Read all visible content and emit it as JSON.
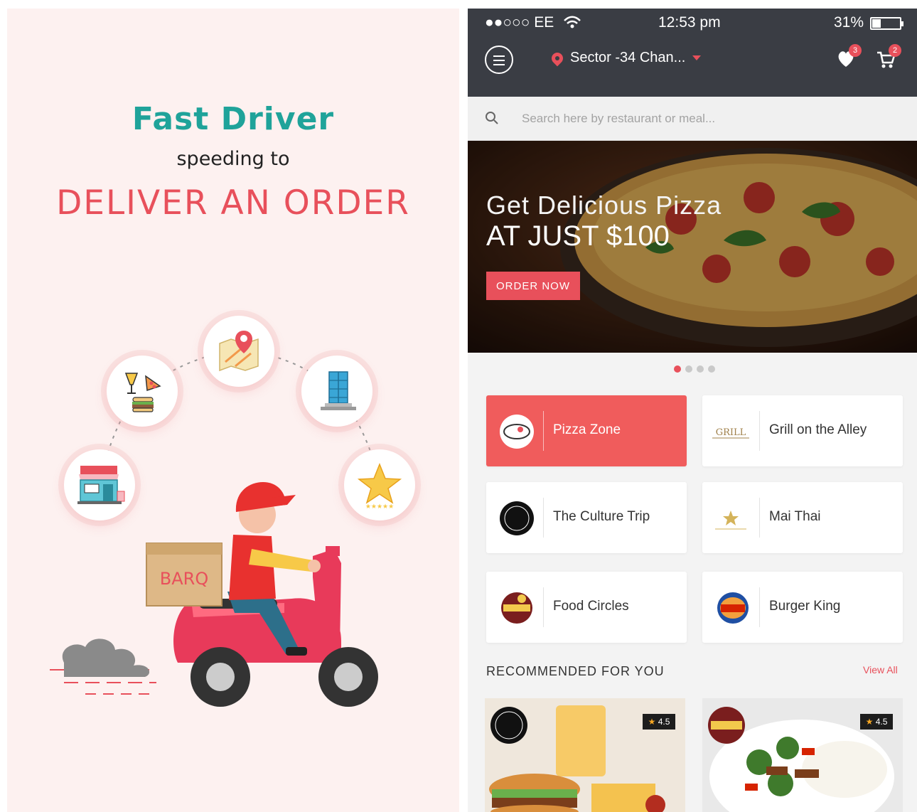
{
  "promo": {
    "title": "Fast Driver",
    "subtitle": "speeding to",
    "headline": "DELIVER AN ORDER",
    "box_label": "BARQ",
    "icons": [
      "food-drink-icon",
      "map-pin-icon",
      "building-icon",
      "store-icon",
      "star-rating-icon"
    ],
    "colors": {
      "teal": "#1fa39a",
      "red": "#e8505b",
      "bg": "#fdf1f0"
    }
  },
  "status_bar": {
    "carrier": "●●○○○ EE",
    "time": "12:53 pm",
    "battery": "31%",
    "battery_level": 0.31
  },
  "header": {
    "location": "Sector -34 Chan...",
    "wishlist_count": "3",
    "cart_count": "2"
  },
  "search": {
    "placeholder": "Search here by restaurant or meal..."
  },
  "banner": {
    "line1": "Get Delicious Pizza",
    "line2": "AT JUST $100",
    "cta": "ORDER NOW",
    "slide_count": 4,
    "active_slide": 0
  },
  "restaurants": [
    {
      "name": "Pizza Zone",
      "active": true
    },
    {
      "name": "Grill on the Alley",
      "active": false
    },
    {
      "name": "The Culture Trip",
      "active": false
    },
    {
      "name": "Mai Thai",
      "active": false
    },
    {
      "name": "Food Circles",
      "active": false
    },
    {
      "name": "Burger King",
      "active": false
    }
  ],
  "recommended": {
    "title": "RECOMMENDED FOR YOU",
    "view_all": "View All",
    "items": [
      {
        "rating": "4.5"
      },
      {
        "rating": "4.5"
      }
    ]
  },
  "accent_color": "#e8505b"
}
